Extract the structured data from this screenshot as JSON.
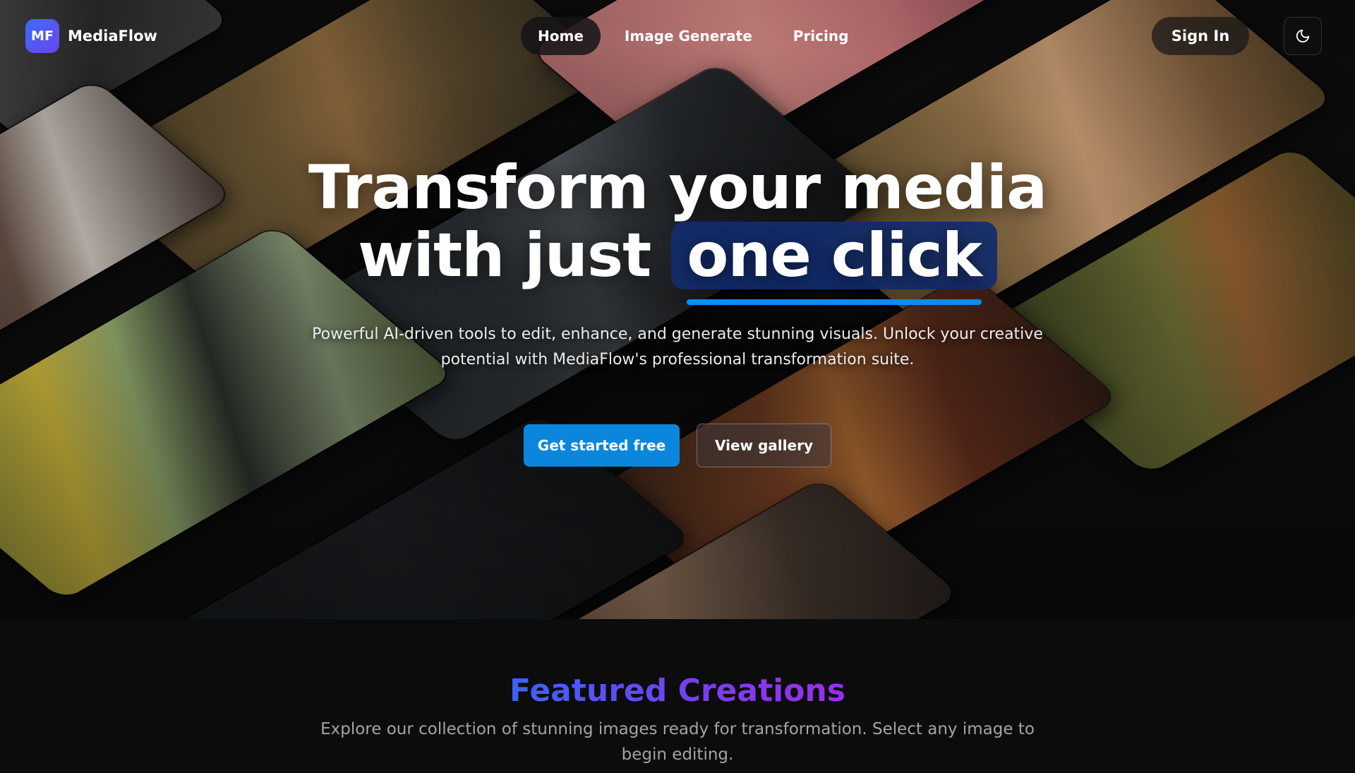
{
  "brand": {
    "badge": "MF",
    "name": "MediaFlow",
    "accent": "#4f5bf3"
  },
  "nav": {
    "items": [
      {
        "label": "Home",
        "active": true
      },
      {
        "label": "Image Generate",
        "active": false
      },
      {
        "label": "Pricing",
        "active": false
      }
    ],
    "sign_in": "Sign In",
    "theme_icon": "moon-icon"
  },
  "hero": {
    "line1": "Transform your media",
    "line2_prefix": "with just",
    "highlight": "one click",
    "subtitle": "Powerful AI-driven tools to edit, enhance, and generate stunning visuals. Unlock your creative potential with MediaFlow's professional transformation suite.",
    "cta_primary": "Get started free",
    "cta_secondary": "View gallery",
    "primary_color": "#0a86dd",
    "highlight_bg": "#122d6e"
  },
  "featured": {
    "title": "Featured Creations",
    "subtitle": "Explore our collection of stunning images ready for transformation. Select any image to begin editing.",
    "gradient": [
      "#3a63f4",
      "#9a2ee8"
    ]
  }
}
